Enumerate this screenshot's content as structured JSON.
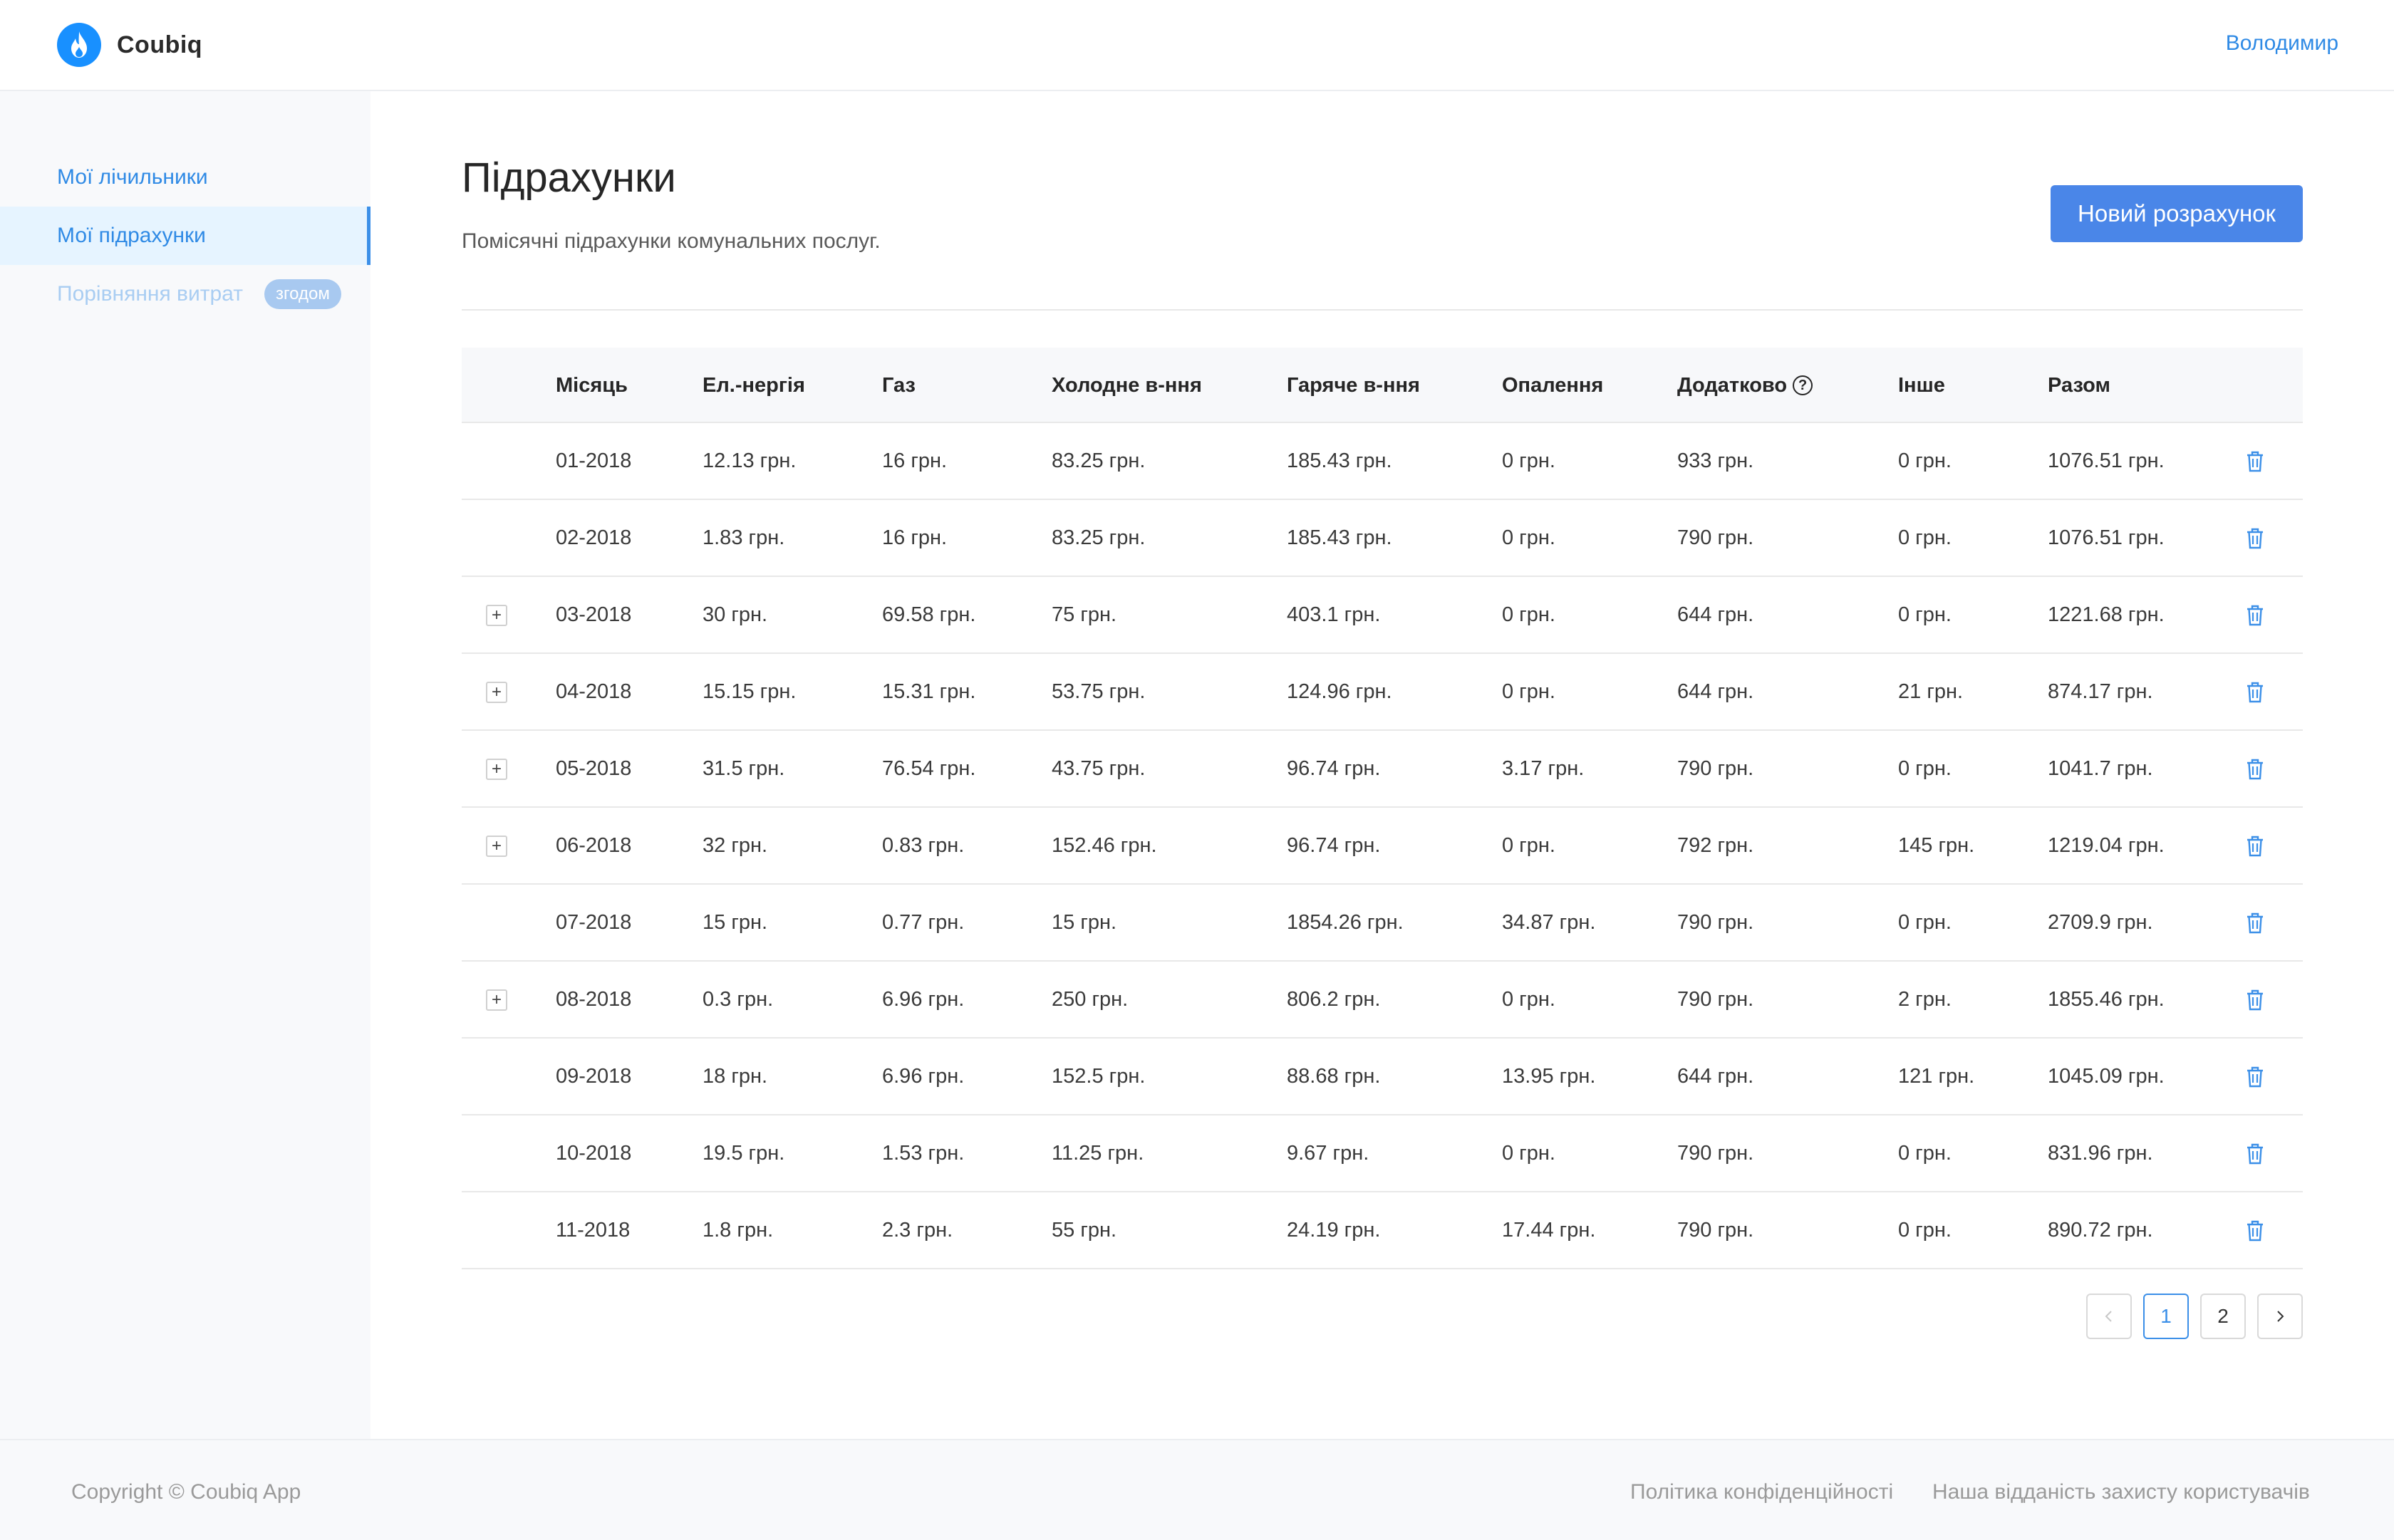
{
  "header": {
    "brand": "Coubiq",
    "user_name": "Володимир",
    "brand_color": "#1890ff"
  },
  "sidebar": {
    "items": [
      {
        "label": "Мої лічильники"
      },
      {
        "label": "Мої підрахунки"
      },
      {
        "label": "Порівняння витрат",
        "badge": "згодом"
      }
    ]
  },
  "main": {
    "title": "Підрахунки",
    "subtitle": "Помісячні підрахунки комунальних послуг.",
    "new_button_label": "Новий розрахунок"
  },
  "table": {
    "headers": {
      "month": "Місяць",
      "electricity": "Ел.-нергія",
      "gas": "Газ",
      "cold_water": "Холодне в-ння",
      "hot_water": "Гаряче в-ння",
      "heating": "Опалення",
      "extra": "Додатково",
      "other": "Інше",
      "total": "Разом"
    },
    "rows": [
      {
        "expandable": false,
        "month": "01-2018",
        "electricity": "12.13 грн.",
        "gas": "16 грн.",
        "cold_water": "83.25 грн.",
        "hot_water": "185.43 грн.",
        "heating": "0 грн.",
        "extra": "933 грн.",
        "other": "0 грн.",
        "total": "1076.51 грн."
      },
      {
        "expandable": false,
        "month": "02-2018",
        "electricity": "1.83 грн.",
        "gas": "16 грн.",
        "cold_water": "83.25 грн.",
        "hot_water": "185.43 грн.",
        "heating": "0 грн.",
        "extra": "790 грн.",
        "other": "0 грн.",
        "total": "1076.51 грн."
      },
      {
        "expandable": true,
        "month": "03-2018",
        "electricity": "30 грн.",
        "gas": "69.58 грн.",
        "cold_water": "75 грн.",
        "hot_water": "403.1 грн.",
        "heating": "0 грн.",
        "extra": "644 грн.",
        "other": "0 грн.",
        "total": "1221.68 грн."
      },
      {
        "expandable": true,
        "month": "04-2018",
        "electricity": "15.15 грн.",
        "gas": "15.31 грн.",
        "cold_water": "53.75 грн.",
        "hot_water": "124.96 грн.",
        "heating": "0 грн.",
        "extra": "644 грн.",
        "other": "21 грн.",
        "total": "874.17 грн."
      },
      {
        "expandable": true,
        "month": "05-2018",
        "electricity": "31.5 грн.",
        "gas": "76.54 грн.",
        "cold_water": "43.75 грн.",
        "hot_water": "96.74 грн.",
        "heating": "3.17 грн.",
        "extra": "790 грн.",
        "other": "0 грн.",
        "total": "1041.7 грн."
      },
      {
        "expandable": true,
        "month": "06-2018",
        "electricity": "32 грн.",
        "gas": "0.83 грн.",
        "cold_water": "152.46 грн.",
        "hot_water": "96.74 грн.",
        "heating": "0 грн.",
        "extra": "792 грн.",
        "other": "145 грн.",
        "total": "1219.04 грн."
      },
      {
        "expandable": false,
        "month": "07-2018",
        "electricity": "15 грн.",
        "gas": "0.77 грн.",
        "cold_water": "15 грн.",
        "hot_water": "1854.26 грн.",
        "heating": "34.87 грн.",
        "extra": "790 грн.",
        "other": "0 грн.",
        "total": "2709.9 грн."
      },
      {
        "expandable": true,
        "month": "08-2018",
        "electricity": "0.3 грн.",
        "gas": "6.96 грн.",
        "cold_water": "250 грн.",
        "hot_water": "806.2 грн.",
        "heating": "0 грн.",
        "extra": "790 грн.",
        "other": "2 грн.",
        "total": "1855.46 грн."
      },
      {
        "expandable": false,
        "month": "09-2018",
        "electricity": "18 грн.",
        "gas": "6.96 грн.",
        "cold_water": "152.5 грн.",
        "hot_water": "88.68 грн.",
        "heating": "13.95 грн.",
        "extra": "644 грн.",
        "other": "121 грн.",
        "total": "1045.09 грн."
      },
      {
        "expandable": false,
        "month": "10-2018",
        "electricity": "19.5 грн.",
        "gas": "1.53 грн.",
        "cold_water": "11.25 грн.",
        "hot_water": "9.67 грн.",
        "heating": "0 грн.",
        "extra": "790 грн.",
        "other": "0 грн.",
        "total": "831.96 грн."
      },
      {
        "expandable": false,
        "month": "11-2018",
        "electricity": "1.8 грн.",
        "gas": "2.3 грн.",
        "cold_water": "55 грн.",
        "hot_water": "24.19 грн.",
        "heating": "17.44 грн.",
        "extra": "790 грн.",
        "other": "0 грн.",
        "total": "890.72 грн."
      }
    ]
  },
  "pagination": {
    "pages": [
      "1",
      "2"
    ],
    "current": "1"
  },
  "footer": {
    "copyright": "Copyright © Coubiq App",
    "privacy_link": "Політика конфіденційності",
    "commitment_link": "Наша відданість захисту користувачів"
  },
  "icons": {
    "logo": "flame-icon",
    "help": "question-circle-icon",
    "expand": "plus-square-icon",
    "delete": "trash-icon",
    "prev": "chevron-left-icon",
    "next": "chevron-right-icon"
  },
  "colors": {
    "accent": "#3b8fe8",
    "button": "#4a86e8",
    "badge": "#a8c9f0"
  }
}
